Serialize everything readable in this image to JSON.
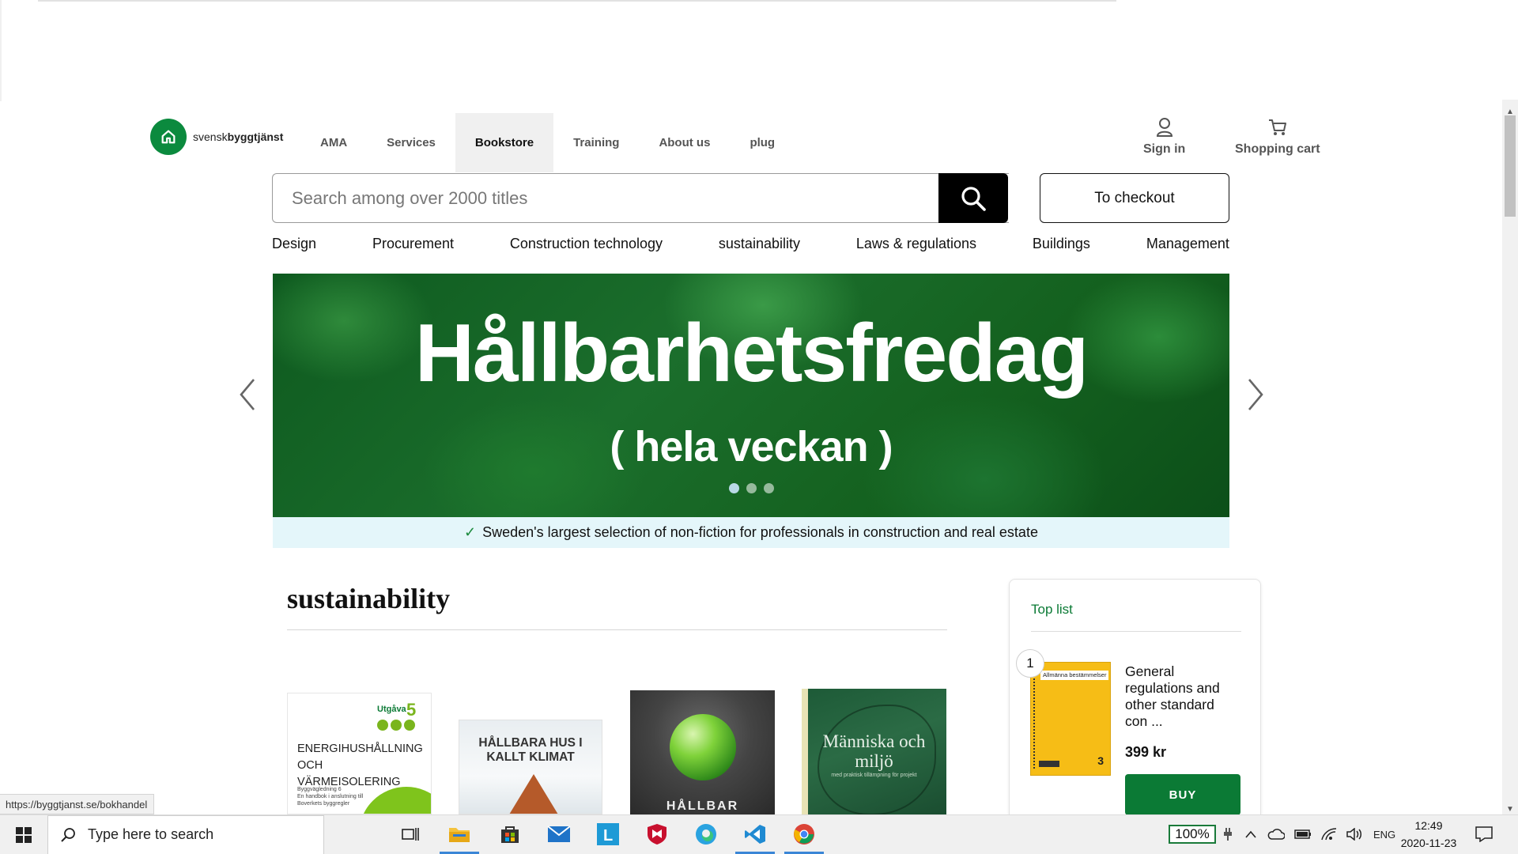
{
  "header": {
    "logo_prefix": "svensk",
    "logo_bold": "byggtjänst",
    "nav": [
      "AMA",
      "Services",
      "Bookstore",
      "Training",
      "About us",
      "plug"
    ],
    "active_nav": "Bookstore",
    "sign_in": "Sign in",
    "shopping_cart": "Shopping cart"
  },
  "search": {
    "placeholder": "Search among over 2000 titles",
    "checkout": "To checkout"
  },
  "categories": [
    "Design",
    "Procurement",
    "Construction technology",
    "sustainability",
    "Laws & regulations",
    "Buildings",
    "Management"
  ],
  "hero": {
    "title": "Hållbarhetsfredag",
    "subtitle": "( hela veckan )",
    "slides": 3,
    "active_slide": 1
  },
  "usp": "Sweden's largest selection of non-fiction for professionals in construction and real estate",
  "section": {
    "title": "sustainability",
    "books": [
      {
        "cover_title": "ENERGIHUSHÅLLNING OCH VÄRMEISOLERING",
        "badge": "Utgåva",
        "edition": "5",
        "small_text": "Byggvägledning 6\nEn handbok i anslutning till\nBoverkets byggregler"
      },
      {
        "cover_title": "HÅLLBARA HUS I KALLT KLIMAT"
      },
      {
        "cover_title": "HÅLLBAR"
      },
      {
        "cover_title": "Människa och miljö",
        "small_text": "med praktisk tillämpning för projekt"
      }
    ]
  },
  "toplist": {
    "title": "Top list",
    "items": [
      {
        "rank": "1",
        "cover_label": "Allmänna bestämmelser",
        "cover_number": "3",
        "name": "General regulations and other standard con ...",
        "price": "399  kr",
        "buy": "BUY"
      }
    ]
  },
  "status_url": "https://byggtjanst.se/bokhandel",
  "taskbar": {
    "search_placeholder": "Type here to search",
    "zoom": "100%",
    "language": "ENG",
    "time": "12:49",
    "date": "2020-11-23"
  },
  "colors": {
    "brand_green": "#0b8a3e",
    "buy_green": "#0b7a35",
    "usp_bg": "#e4f6fa"
  }
}
